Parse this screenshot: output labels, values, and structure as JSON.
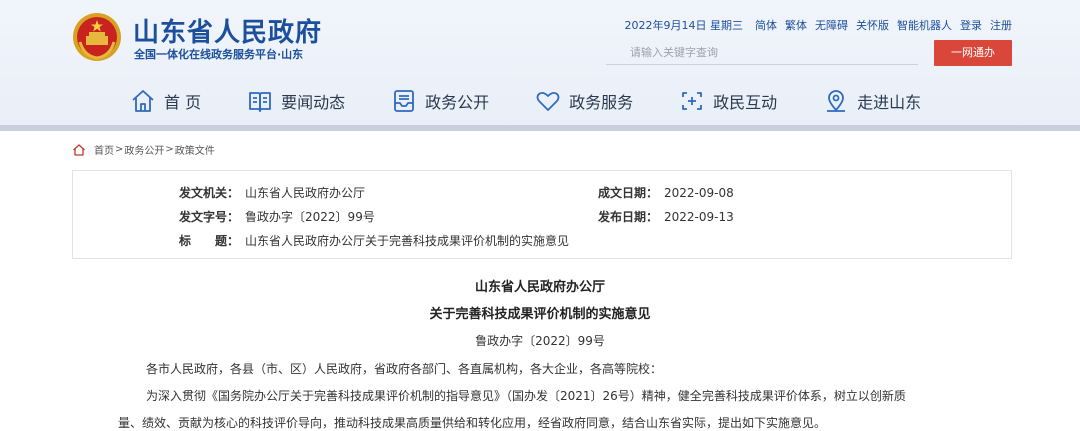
{
  "header": {
    "site_title": "山东省人民政府",
    "site_subtitle": "全国一体化在线政务服务平台·山东",
    "date": "2022年9月14日 星期三",
    "top_links": [
      "简体",
      "繁体",
      "无障碍",
      "关怀版",
      "智能机器人",
      "登录",
      "注册"
    ],
    "search_placeholder": "请输入关键字查询",
    "login_button": "一网通办"
  },
  "nav": {
    "items": [
      {
        "label": "首 页",
        "icon": "home-icon"
      },
      {
        "label": "要闻动态",
        "icon": "book-icon"
      },
      {
        "label": "政务公开",
        "icon": "inbox-icon"
      },
      {
        "label": "政务服务",
        "icon": "heart-icon"
      },
      {
        "label": "政民互动",
        "icon": "link-icon"
      },
      {
        "label": "走进山东",
        "icon": "map-pin-icon"
      }
    ]
  },
  "breadcrumb": {
    "items": [
      "首页",
      "政务公开",
      "政策文件"
    ],
    "separator": ">"
  },
  "meta": {
    "issuer_label": "发文机关：",
    "issuer": "山东省人民政府办公厅",
    "doc_no_label": "发文字号：",
    "doc_no": "鲁政办字〔2022〕99号",
    "title_label": "标　　题：",
    "title": "山东省人民政府办公厅关于完善科技成果评价机制的实施意见",
    "created_label": "成文日期：",
    "created": "2022-09-08",
    "published_label": "发布日期：",
    "published": "2022-09-13"
  },
  "article": {
    "org": "山东省人民政府办公厅",
    "title": "关于完善科技成果评价机制的实施意见",
    "doc_no": "鲁政办字〔2022〕99号",
    "salutation": "各市人民政府，各县（市、区）人民政府，省政府各部门、各直属机构，各大企业，各高等院校：",
    "para1_line1": "为深入贯彻《国务院办公厅关于完善科技成果评价机制的指导意见》（国办发〔2021〕26号）精神，健全完善科技成果评价体系，树立以创新质",
    "para1_line2": "量、绩效、贡献为核心的科技评价导向，推动科技成果高质量供给和转化应用，经省政府同意，结合山东省实际，提出如下实施意见。"
  },
  "colors": {
    "brand_blue": "#1c4f9c",
    "button_red": "#d9473a",
    "header_bg": "#eef3fa"
  }
}
